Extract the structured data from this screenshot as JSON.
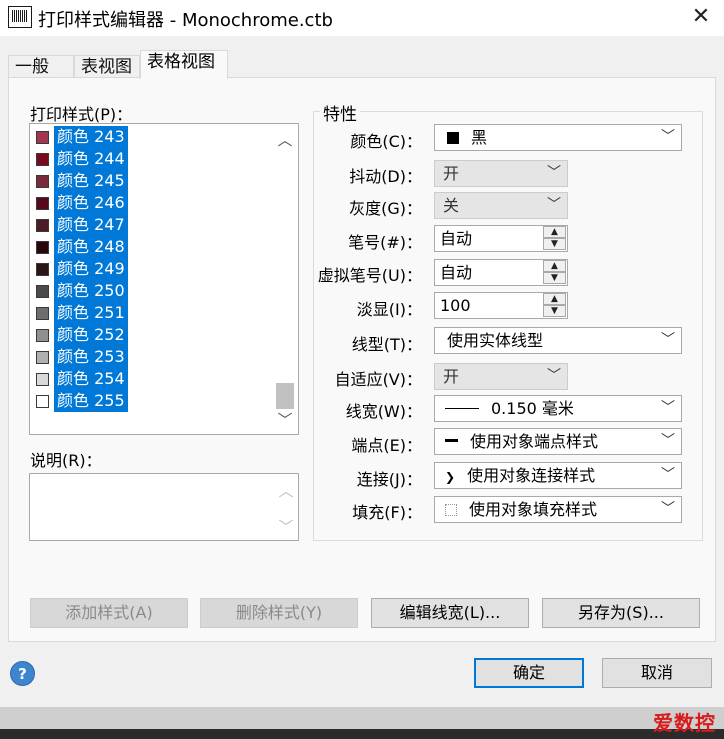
{
  "window": {
    "title": "打印样式编辑器 - Monochrome.ctb",
    "close_glyph": "✕"
  },
  "tabs": [
    {
      "label": "一般"
    },
    {
      "label": "表视图"
    },
    {
      "label": "表格视图"
    }
  ],
  "styles_panel": {
    "label": "打印样式(P)：",
    "items": [
      {
        "label": "颜色 243",
        "swatch_color": "#a0374e"
      },
      {
        "label": "颜色 244",
        "swatch_color": "#7a0a1f"
      },
      {
        "label": "颜色 245",
        "swatch_color": "#7a2a3a"
      },
      {
        "label": "颜色 246",
        "swatch_color": "#55091a"
      },
      {
        "label": "颜色 247",
        "swatch_color": "#4e1c25"
      },
      {
        "label": "颜色 248",
        "swatch_color": "#2a0509"
      },
      {
        "label": "颜色 249",
        "swatch_color": "#2a1517"
      },
      {
        "label": "颜色 250",
        "swatch_color": "#4a4a4a"
      },
      {
        "label": "颜色 251",
        "swatch_color": "#6e6e6e"
      },
      {
        "label": "颜色 252",
        "swatch_color": "#909090"
      },
      {
        "label": "颜色 253",
        "swatch_color": "#b0b0b0"
      },
      {
        "label": "颜色 254",
        "swatch_color": "#d9d9d9"
      },
      {
        "label": "颜色 255",
        "swatch_color": "#ffffff"
      }
    ],
    "description_label": "说明(R)："
  },
  "properties": {
    "group_title": "特性",
    "color": {
      "label": "颜色(C)：",
      "value": "黑",
      "swatch_color": "#000000"
    },
    "dither": {
      "label": "抖动(D)：",
      "value": "开"
    },
    "grayscale": {
      "label": "灰度(G)：",
      "value": "关"
    },
    "pen_number": {
      "label": "笔号(#)：",
      "value": "自动"
    },
    "virtual_pen": {
      "label": "虚拟笔号(U)：",
      "value": "自动"
    },
    "screening": {
      "label": "淡显(I)：",
      "value": "100"
    },
    "linetype": {
      "label": "线型(T)：",
      "value": "使用实体线型"
    },
    "adaptive": {
      "label": "自适应(V)：",
      "value": "开"
    },
    "lineweight": {
      "label": "线宽(W)：",
      "value": "0.150  毫米"
    },
    "line_end": {
      "label": "端点(E)：",
      "value": "使用对象端点样式"
    },
    "line_join": {
      "label": "连接(J)：",
      "value": "使用对象连接样式"
    },
    "fill": {
      "label": "填充(F)：",
      "value": "使用对象填充样式"
    }
  },
  "buttons": {
    "add_style": "添加样式(A)",
    "delete_style": "删除样式(Y)",
    "edit_lineweights": "编辑线宽(L)...",
    "save_as": "另存为(S)...",
    "ok": "确定",
    "cancel": "取消",
    "help": "?"
  },
  "watermark": "爱数控",
  "colors": {
    "selection": "#0078d7",
    "dialog_bg": "#f0f0f0",
    "panel_bg": "#f9f9f9",
    "watermark": "#d81b1b"
  }
}
